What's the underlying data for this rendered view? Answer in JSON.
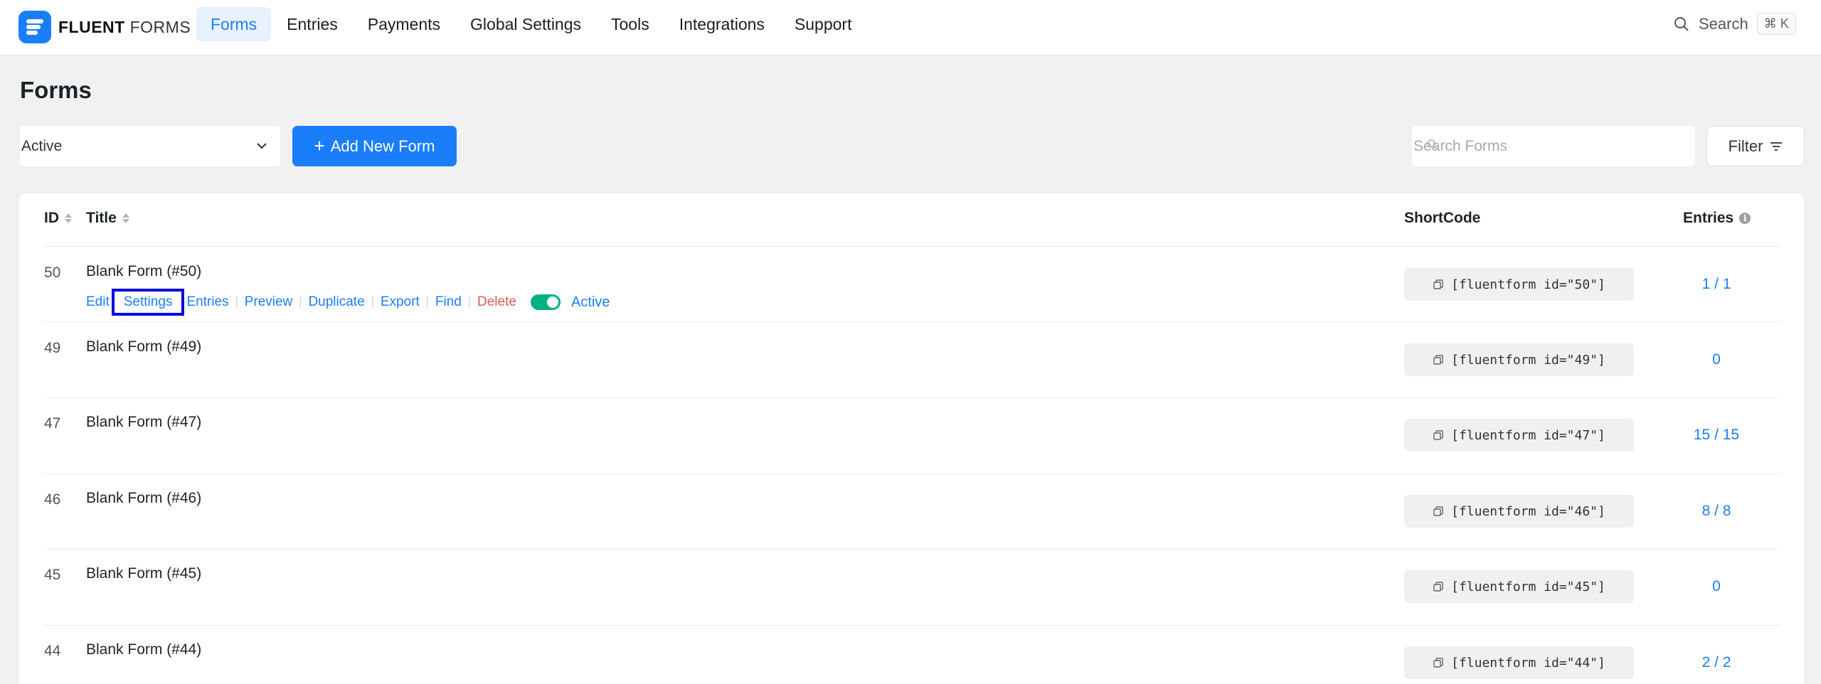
{
  "brand": {
    "name_bold": "FLUENT",
    "name_light": "FORMS"
  },
  "nav": [
    {
      "label": "Forms",
      "active": true
    },
    {
      "label": "Entries",
      "active": false
    },
    {
      "label": "Payments",
      "active": false
    },
    {
      "label": "Global Settings",
      "active": false
    },
    {
      "label": "Tools",
      "active": false
    },
    {
      "label": "Integrations",
      "active": false
    },
    {
      "label": "Support",
      "active": false
    }
  ],
  "top_search": {
    "label": "Search",
    "shortcut": "⌘ K"
  },
  "page": {
    "title": "Forms"
  },
  "toolbar": {
    "status_value": "Active",
    "add_label": "Add New Form",
    "search_placeholder": "Search Forms",
    "filter_label": "Filter"
  },
  "table": {
    "headers": {
      "id": "ID",
      "title": "Title",
      "shortcode": "ShortCode",
      "entries": "Entries"
    },
    "row_actions": {
      "edit": "Edit",
      "settings": "Settings",
      "entries": "Entries",
      "preview": "Preview",
      "duplicate": "Duplicate",
      "export": "Export",
      "find": "Find",
      "delete": "Delete",
      "status": "Active"
    },
    "rows": [
      {
        "id": "50",
        "title": "Blank Form (#50)",
        "shortcode": "[fluentform id=\"50\"]",
        "entries": "1 / 1"
      },
      {
        "id": "49",
        "title": "Blank Form (#49)",
        "shortcode": "[fluentform id=\"49\"]",
        "entries": "0"
      },
      {
        "id": "47",
        "title": "Blank Form (#47)",
        "shortcode": "[fluentform id=\"47\"]",
        "entries": "15 / 15"
      },
      {
        "id": "46",
        "title": "Blank Form (#46)",
        "shortcode": "[fluentform id=\"46\"]",
        "entries": "8 / 8"
      },
      {
        "id": "45",
        "title": "Blank Form (#45)",
        "shortcode": "[fluentform id=\"45\"]",
        "entries": "0"
      },
      {
        "id": "44",
        "title": "Blank Form (#44)",
        "shortcode": "[fluentform id=\"44\"]",
        "entries": "2 / 2"
      }
    ]
  },
  "colors": {
    "accent": "#1a7efb",
    "danger": "#e2594f",
    "toggle_on": "#00b27f",
    "highlight_box": "#0000dd"
  },
  "icons": {
    "logo": "fluent-forms-logo-icon",
    "search": "search-icon",
    "chevron": "chevron-down-icon",
    "plus": "plus-icon",
    "filter": "filter-lines-icon",
    "copy": "copy-icon",
    "info": "info-icon"
  }
}
